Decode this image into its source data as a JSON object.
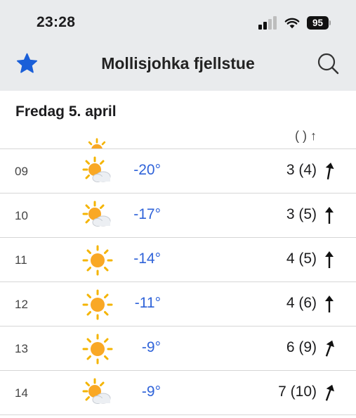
{
  "status": {
    "time": "23:28",
    "battery": "95"
  },
  "header": {
    "title": "Mollisjohka fjellstue",
    "star_icon": "star-icon",
    "search_icon": "search-icon",
    "accent": "#1a5fd8"
  },
  "day": {
    "label": "Fredag 5. april"
  },
  "rows": [
    {
      "hour": "09",
      "icon": "partly-cloudy-icon",
      "temp": "-20°",
      "wind": "3 (4)",
      "dir": 10
    },
    {
      "hour": "10",
      "icon": "partly-cloudy-icon",
      "temp": "-17°",
      "wind": "3 (5)",
      "dir": 0
    },
    {
      "hour": "11",
      "icon": "sun-icon",
      "temp": "-14°",
      "wind": "4 (5)",
      "dir": 0
    },
    {
      "hour": "12",
      "icon": "sun-icon",
      "temp": "-11°",
      "wind": "4 (6)",
      "dir": 0
    },
    {
      "hour": "13",
      "icon": "sun-icon",
      "temp": "-9°",
      "wind": "6 (9)",
      "dir": 20
    },
    {
      "hour": "14",
      "icon": "partly-cloudy-icon",
      "temp": "-9°",
      "wind": "7 (10)",
      "dir": 20
    }
  ],
  "colors": {
    "temperature": "#2f63d9",
    "header_bg": "#e9ebed"
  }
}
